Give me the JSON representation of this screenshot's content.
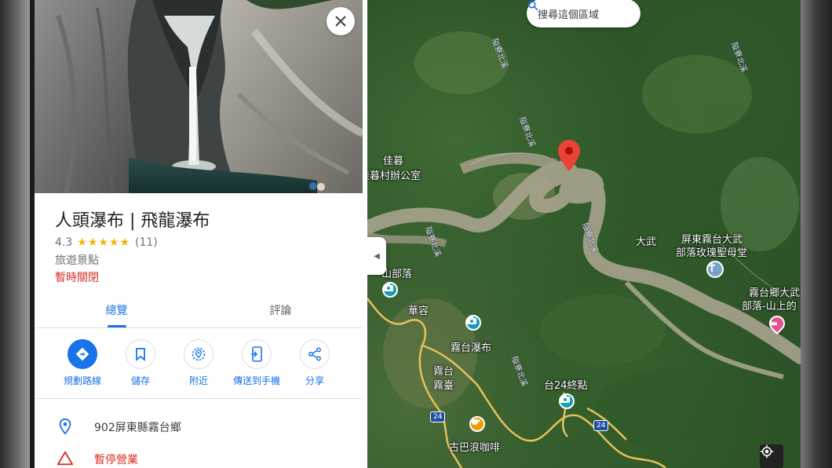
{
  "map": {
    "search_area_label": "搜尋這個區域",
    "labels": {
      "jiamu": "佳暮",
      "jiamu_office": "佳暮村辦公室",
      "dawu": "大武",
      "church": "屏東霧台大武",
      "church2": "部落玫瑰聖母堂",
      "shanbuluo": "山部落",
      "huarong": "華容",
      "wutai_waterfall": "霧台瀑布",
      "wutai1": "霧台",
      "wutai2": "霧臺",
      "tai24_end": "台24終點",
      "guba_cafe": "古巴浪咖啡",
      "wutai_dawu1": "霧台鄉大武",
      "wutai_dawu2": "部落-山上的"
    },
    "road_labels": [
      "隘寮北溪",
      "隘寮北溪",
      "隘寮北溪",
      "隘寮北溪",
      "隘寮北溪",
      "隘寮北溪"
    ],
    "route_shields": [
      "24",
      "24"
    ],
    "colors": {
      "pin": "#ea4335",
      "camera_poi": "#1a9bb5",
      "cafe_poi": "#f29900",
      "lodging_poi": "#e8508e",
      "church_poi": "#7aa2c9"
    }
  },
  "panel": {
    "title": "人頭瀑布 | 飛龍瀑布",
    "rating": "4.3",
    "stars": "★★★★★",
    "review_count": "(11)",
    "category": "旅遊景點",
    "status": "暫時關閉",
    "tabs": [
      {
        "label": "總覽",
        "active": true
      },
      {
        "label": "評論",
        "active": false
      }
    ],
    "actions": [
      {
        "label": "規劃路線",
        "icon": "directions-icon"
      },
      {
        "label": "儲存",
        "icon": "bookmark-icon"
      },
      {
        "label": "附近",
        "icon": "nearby-icon"
      },
      {
        "label": "傳送到手機",
        "icon": "send-to-phone-icon"
      },
      {
        "label": "分享",
        "icon": "share-icon"
      }
    ],
    "address": "902屏東縣霧台鄉",
    "closure_notice": "暫停營業"
  }
}
